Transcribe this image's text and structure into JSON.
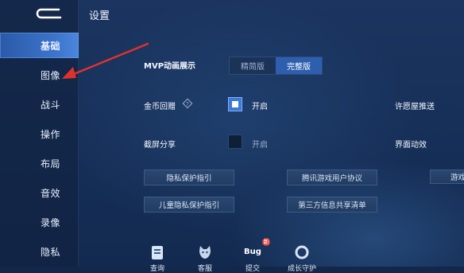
{
  "header": {
    "title": "设置"
  },
  "sidebar": {
    "items": [
      {
        "label": "基础",
        "active": true
      },
      {
        "label": "图像"
      },
      {
        "label": "战斗"
      },
      {
        "label": "操作"
      },
      {
        "label": "布局"
      },
      {
        "label": "音效"
      },
      {
        "label": "录像"
      },
      {
        "label": "隐私"
      }
    ]
  },
  "settings": {
    "mvp_label": "MVP动画展示",
    "mvp_options": [
      "精简版",
      "完整版"
    ],
    "mvp_selected": "完整版",
    "gold_label": "金币回赠",
    "gold_value": "开启",
    "gold_checked": true,
    "screenshot_label": "截屏分享",
    "screenshot_value": "开启",
    "screenshot_checked": false,
    "wish_label": "许愿屋推送",
    "ui_anim_label": "界面动效"
  },
  "links": [
    "隐私保护指引",
    "腾讯游戏用户协议",
    "游戏",
    "儿童隐私保护指引",
    "第三方信息共享清单"
  ],
  "dock": [
    {
      "label": "查询",
      "icon": "query-icon"
    },
    {
      "label": "客服",
      "icon": "cat-support-icon"
    },
    {
      "label": "提交",
      "icon": "bug-icon",
      "icon_text": "Bug",
      "badge": "新"
    },
    {
      "label": "成长守护",
      "icon": "ring-icon"
    }
  ],
  "colors": {
    "accent": "#3c74cb",
    "arrow": "#e0322c",
    "background": "#163059"
  }
}
